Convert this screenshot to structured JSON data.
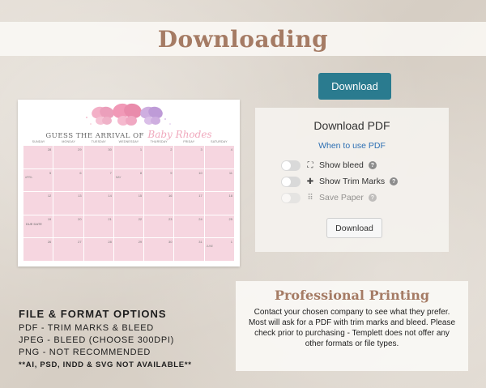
{
  "banner": {
    "title": "Downloading"
  },
  "top_button": {
    "label": "Download"
  },
  "calendar": {
    "title_main": "GUESS THE ARRIVAL OF",
    "title_name": "Baby Rhodes",
    "weekdays": [
      "SUNDAY",
      "MONDAY",
      "TUESDAY",
      "WEDNESDAY",
      "THURSDAY",
      "FRIDAY",
      "SATURDAY"
    ],
    "cells": [
      {
        "num": "28"
      },
      {
        "num": "29"
      },
      {
        "num": "30"
      },
      {
        "num": "1"
      },
      {
        "num": "2"
      },
      {
        "num": "3"
      },
      {
        "num": "4"
      },
      {
        "num": "5",
        "label": "APRIL"
      },
      {
        "num": "6"
      },
      {
        "num": "7"
      },
      {
        "num": "8",
        "label": "MAY"
      },
      {
        "num": "9"
      },
      {
        "num": "10"
      },
      {
        "num": "11"
      },
      {
        "num": "12"
      },
      {
        "num": "13"
      },
      {
        "num": "14"
      },
      {
        "num": "15"
      },
      {
        "num": "16"
      },
      {
        "num": "17"
      },
      {
        "num": "18"
      },
      {
        "num": "19",
        "due": "DUE DATE"
      },
      {
        "num": "20"
      },
      {
        "num": "21"
      },
      {
        "num": "22"
      },
      {
        "num": "23"
      },
      {
        "num": "24"
      },
      {
        "num": "25"
      },
      {
        "num": "26"
      },
      {
        "num": "27"
      },
      {
        "num": "28"
      },
      {
        "num": "29"
      },
      {
        "num": "30"
      },
      {
        "num": "31"
      },
      {
        "num": "1",
        "label": "JUNE"
      }
    ]
  },
  "pdf_panel": {
    "title": "Download PDF",
    "link": "When to use PDF",
    "options": [
      {
        "label": "Show bleed",
        "icon": "bleed-icon",
        "glyph": "⛶",
        "enabled": true
      },
      {
        "label": "Show Trim Marks",
        "icon": "trim-marks-icon",
        "glyph": "✚",
        "enabled": true
      },
      {
        "label": "Save Paper",
        "icon": "save-paper-icon",
        "glyph": "⠿",
        "enabled": false
      }
    ],
    "download_label": "Download"
  },
  "file_options": {
    "heading": "FILE & FORMAT OPTIONS",
    "lines": [
      "PDF - TRIM MARKS & BLEED",
      "JPEG - BLEED (CHOOSE 300DPI)",
      "PNG - NOT RECOMMENDED",
      "**AI, PSD, INDD & SVG NOT AVAILABLE**"
    ]
  },
  "professional_printing": {
    "title": "Professional Printing",
    "body": "Contact your chosen company to see what they prefer. Most will ask for a PDF with trim marks and bleed. Please check prior to purchasing - Templett does not offer any other formats or file types."
  },
  "colors": {
    "accent_brown": "#a57b64",
    "button_teal": "#2a7b8f",
    "link_blue": "#2d6fb3",
    "calendar_pink": "#f6d6e0"
  }
}
